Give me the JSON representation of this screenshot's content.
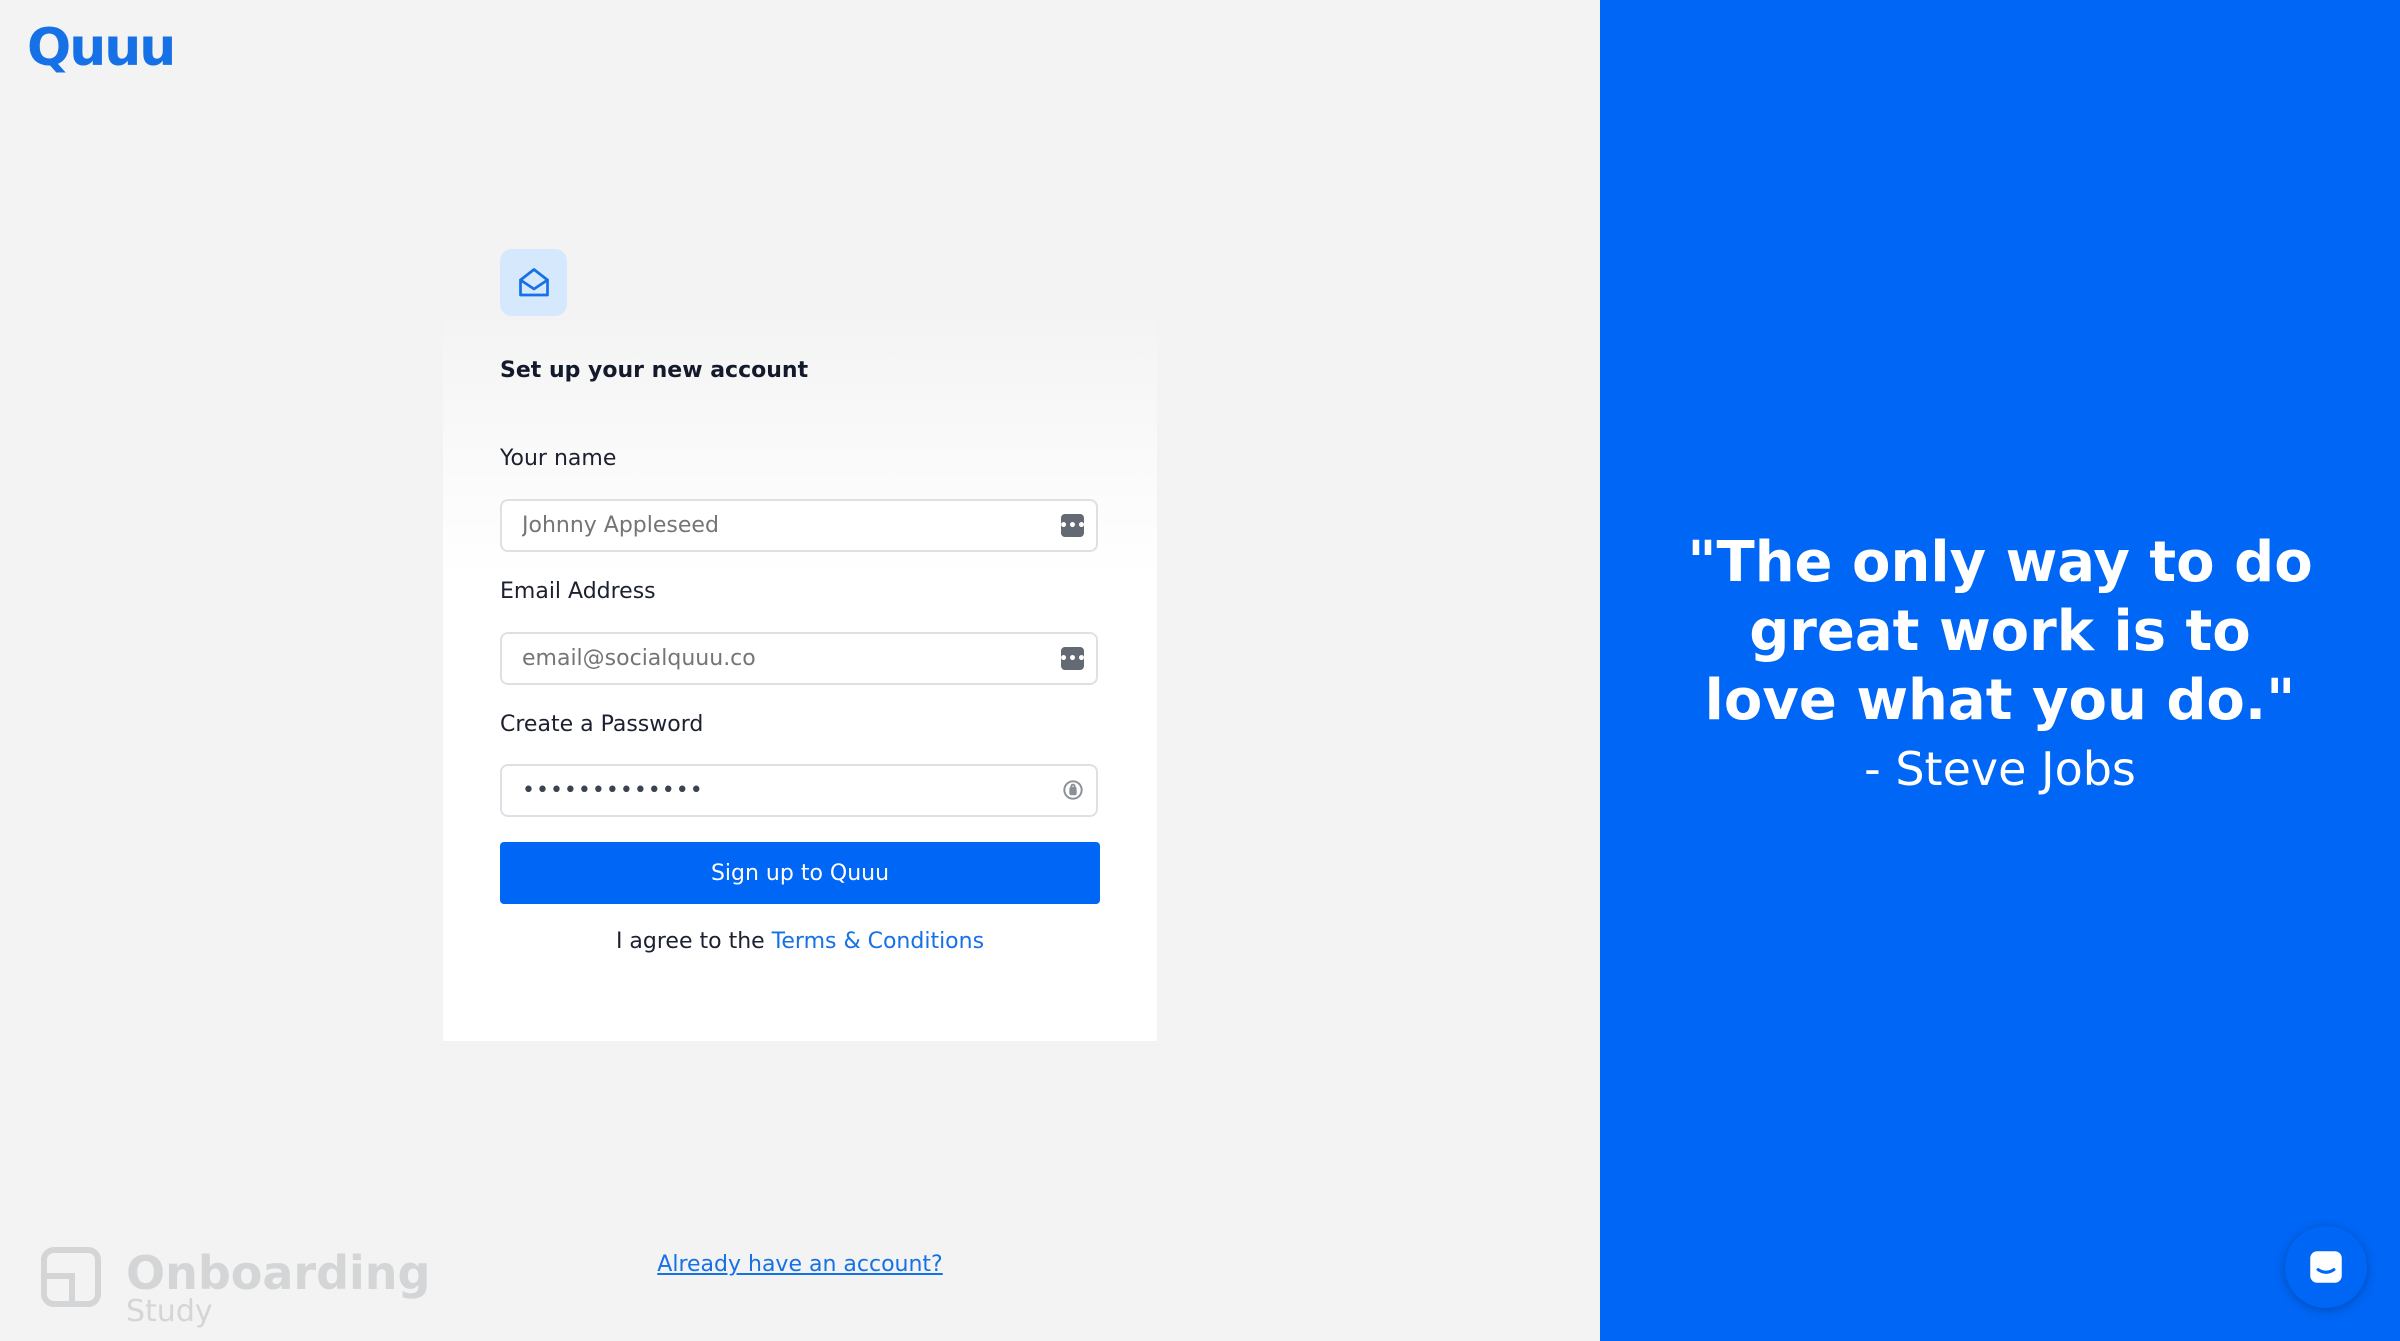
{
  "brand": {
    "logo_text": "Quuu",
    "primary_color": "#0066f5",
    "link_color": "#1670e6"
  },
  "form": {
    "title": "Set up your new account",
    "name": {
      "label": "Your name",
      "value": "",
      "placeholder": "Johnny Appleseed"
    },
    "email": {
      "label": "Email Address",
      "value": "",
      "placeholder": "email@socialquuu.co"
    },
    "password": {
      "label": "Create a Password",
      "value": "•••••••••••••"
    },
    "submit_label": "Sign up to Quuu",
    "agree_prefix": "I agree to the ",
    "terms_link": "Terms & Conditions",
    "login_link": "Already have an account?"
  },
  "icons": {
    "header": "envelope-open-icon",
    "field_action": "password-manager-icon",
    "password_action": "key-icon",
    "chat": "chat-icon"
  },
  "watermark": {
    "title": "Onboarding",
    "subtitle": "Study"
  },
  "quote": {
    "text": "\"The only way to do great work is to love what you do.\"",
    "author": "- Steve Jobs"
  }
}
